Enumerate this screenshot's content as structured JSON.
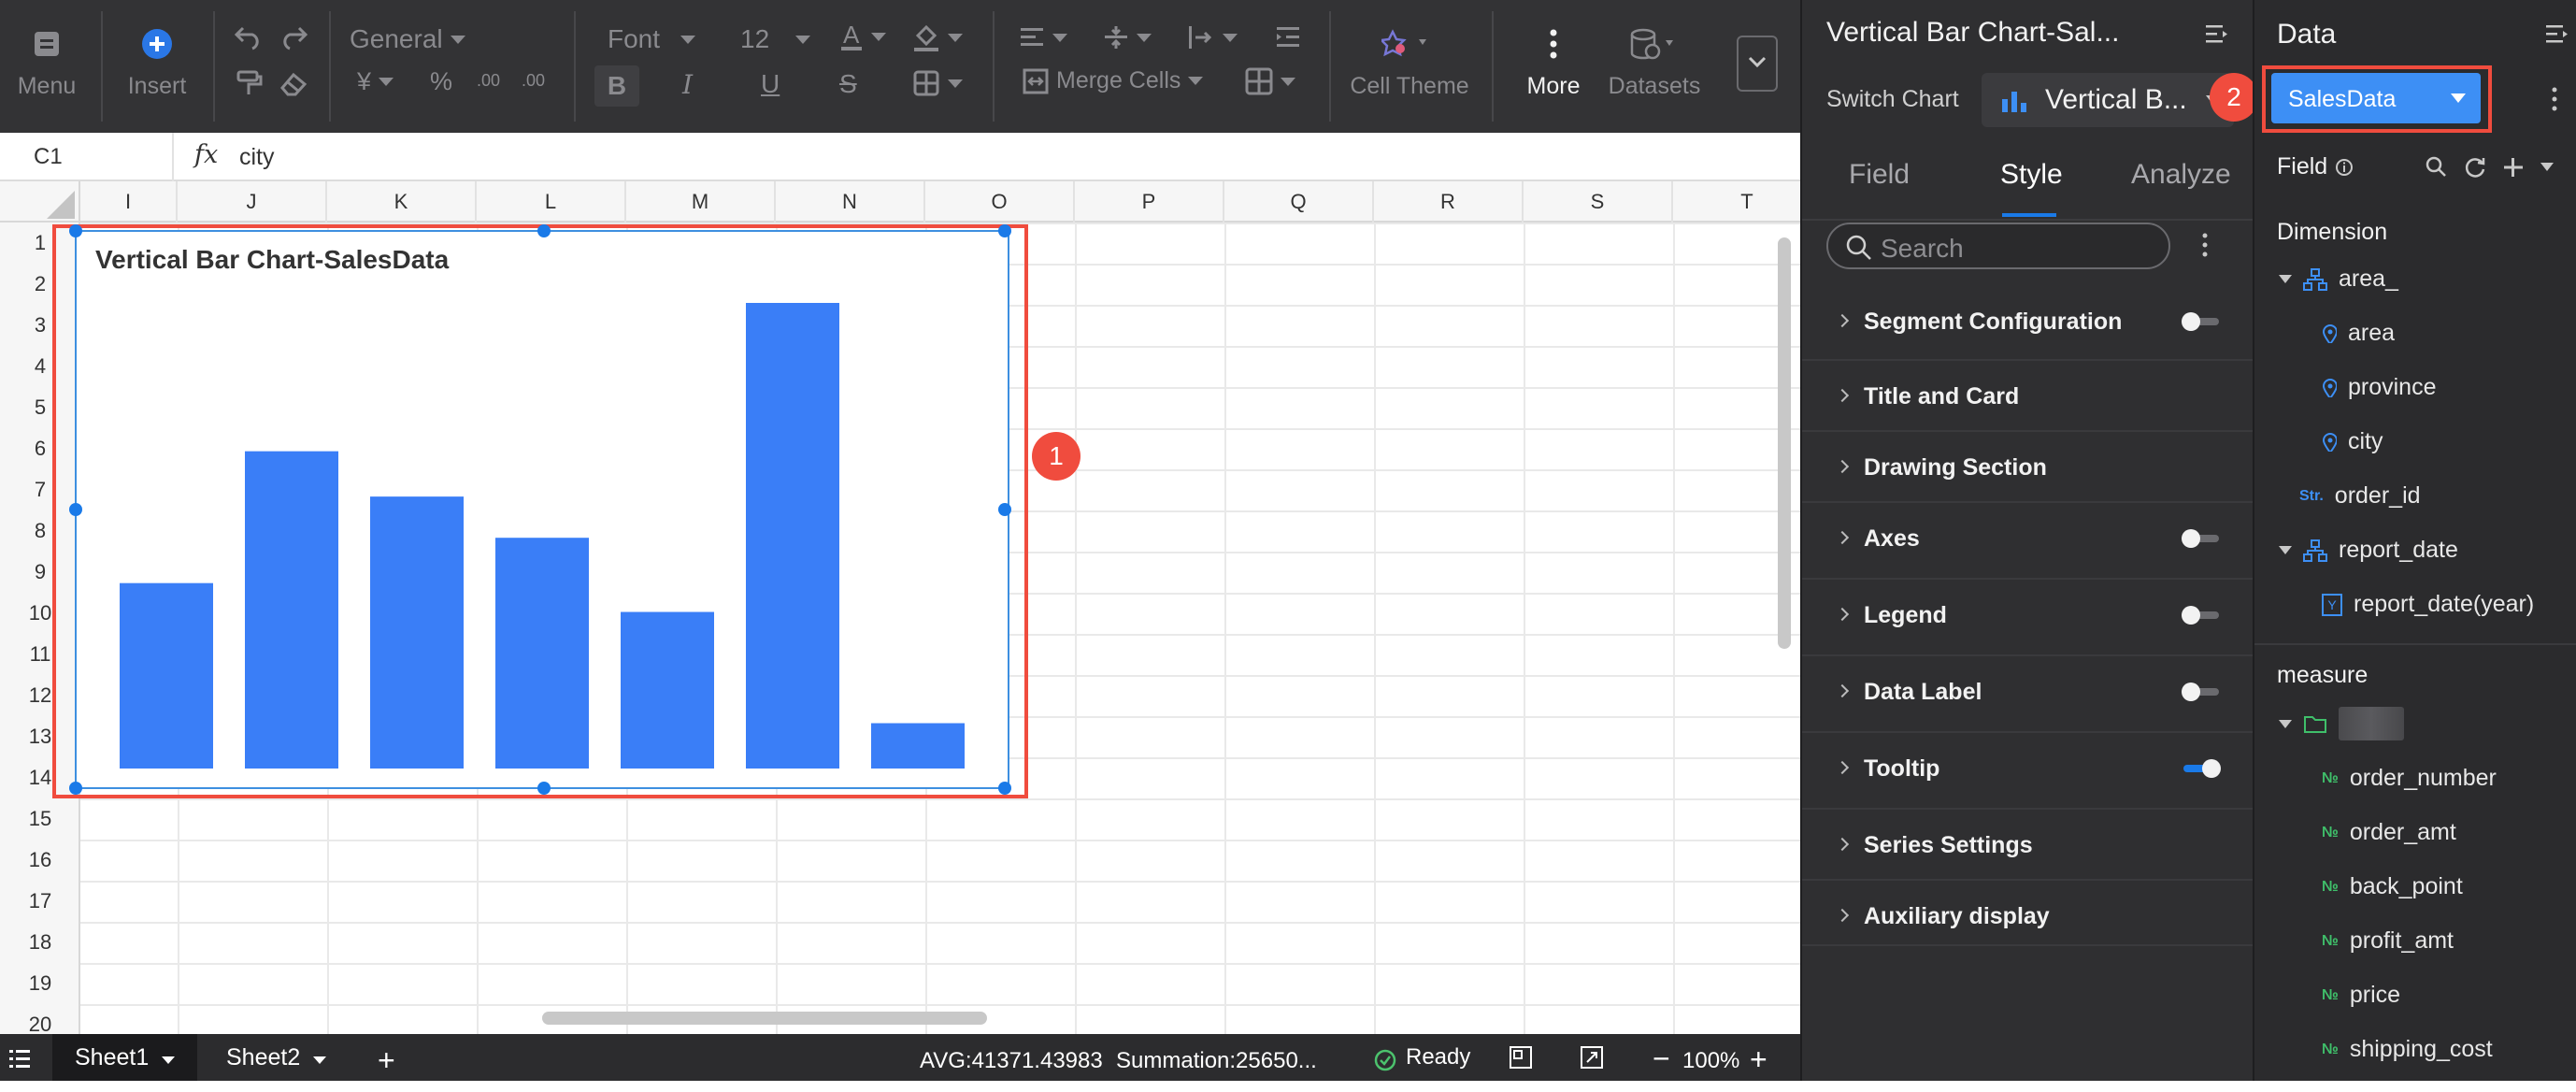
{
  "toolbar": {
    "menu_label": "Menu",
    "insert_label": "Insert",
    "number_format": "General",
    "font_family": "Font",
    "font_size": "12",
    "merge_cells_label": "Merge Cells",
    "cell_theme_label": "Cell Theme",
    "more_label": "More",
    "datasets_label": "Datasets"
  },
  "formula_bar": {
    "cell_ref": "C1",
    "fx": "fx",
    "value": "city"
  },
  "grid": {
    "columns": [
      "I",
      "J",
      "K",
      "L",
      "M",
      "N",
      "O",
      "P",
      "Q",
      "R",
      "S",
      "T"
    ],
    "rows": [
      "1",
      "2",
      "3",
      "4",
      "5",
      "6",
      "7",
      "8",
      "9",
      "10",
      "11",
      "12",
      "13",
      "14",
      "15",
      "16",
      "17",
      "18",
      "19",
      "20"
    ]
  },
  "chart_data": {
    "type": "bar",
    "title": "Vertical Bar Chart-SalesData",
    "categories": [
      "",
      "",
      "",
      "",
      "",
      "",
      ""
    ],
    "values": [
      4.5,
      7.7,
      6.6,
      5.6,
      3.8,
      11.3,
      1.1
    ],
    "ylim": [
      0,
      11.3
    ],
    "grid": false,
    "legend": "none",
    "bar_color": "#3a7ef7"
  },
  "callouts": {
    "chart": "1",
    "dataset": "2"
  },
  "statusbar": {
    "sheets": [
      "Sheet1",
      "Sheet2"
    ],
    "add_sheet": "+",
    "avg": "AVG:41371.43983",
    "sum": "Summation:25650...",
    "ready": "Ready",
    "zoom": "100%"
  },
  "style_panel": {
    "title": "Vertical Bar Chart-Sal...",
    "switch_chart_label": "Switch Chart",
    "chart_type_value": "Vertical B...",
    "tabs": [
      "Field",
      "Style",
      "Analyze"
    ],
    "search_placeholder": "Search",
    "sections": [
      {
        "name": "Segment Configuration",
        "toggle": "off"
      },
      {
        "name": "Title and Card",
        "toggle": "none"
      },
      {
        "name": "Drawing Section",
        "toggle": "none"
      },
      {
        "name": "Axes",
        "toggle": "off"
      },
      {
        "name": "Legend",
        "toggle": "off"
      },
      {
        "name": "Data Label",
        "toggle": "off"
      },
      {
        "name": "Tooltip",
        "toggle": "on"
      },
      {
        "name": "Series Settings",
        "toggle": "none"
      },
      {
        "name": "Auxiliary display",
        "toggle": "none"
      }
    ]
  },
  "data_panel": {
    "title": "Data",
    "dataset": "SalesData",
    "field_label": "Field",
    "dimension_label": "Dimension",
    "dimension_group": "area_",
    "geo_fields": [
      "area",
      "province",
      "city"
    ],
    "str_badge": "Str.",
    "order_id": "order_id",
    "date_group": "report_date",
    "date_field": "report_date(year)",
    "date_badge": "Y",
    "measure_label": "measure",
    "measure_badge": "№",
    "measures": [
      "order_number",
      "order_amt",
      "back_point",
      "profit_amt",
      "price",
      "shipping_cost"
    ]
  }
}
